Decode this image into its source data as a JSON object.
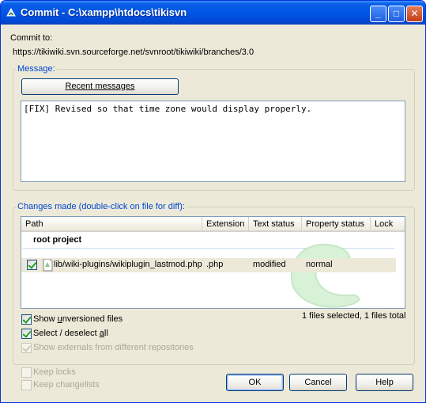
{
  "window": {
    "title": "Commit - C:\\xampp\\htdocs\\tikisvn",
    "minimize_label": "_",
    "maximize_label": "□",
    "close_label": "✕"
  },
  "commit_to": {
    "label": "Commit to:",
    "url": "https://tikiwiki.svn.sourceforge.net/svnroot/tikiwiki/branches/3.0"
  },
  "message_group": {
    "title": "Message:",
    "recent_button": "Recent messages",
    "text": "[FIX] Revised so that time zone would display properly."
  },
  "changes_group": {
    "title": "Changes made (double-click on file for diff):",
    "columns": [
      "Path",
      "Extension",
      "Text status",
      "Property status",
      "Lock"
    ],
    "group_header": "root project",
    "rows": [
      {
        "checked": true,
        "path": "lib/wiki-plugins/wikiplugin_lastmod.php",
        "extension": ".php",
        "text_status": "modified",
        "property_status": "normal",
        "lock": ""
      }
    ],
    "summary": "1 files selected, 1 files total"
  },
  "options": {
    "show_unversioned": {
      "label_pre": "Show ",
      "label_u": "u",
      "label_post": "nversioned files",
      "checked": true
    },
    "select_all": {
      "label_pre": "Select / deselect ",
      "label_u": "a",
      "label_post": "ll",
      "checked": true
    },
    "show_externals": {
      "label": "Show externals from different repositories",
      "checked": true,
      "disabled": true
    },
    "keep_locks": {
      "label": "Keep locks",
      "checked": false,
      "disabled": true
    },
    "keep_changelists": {
      "label": "Keep changelists",
      "checked": false,
      "disabled": true
    }
  },
  "buttons": {
    "ok": "OK",
    "cancel": "Cancel",
    "help": "Help"
  },
  "colors": {
    "titlebar": "#0055e5",
    "dialog_bg": "#ece9d8",
    "group_title": "#0046d5"
  }
}
